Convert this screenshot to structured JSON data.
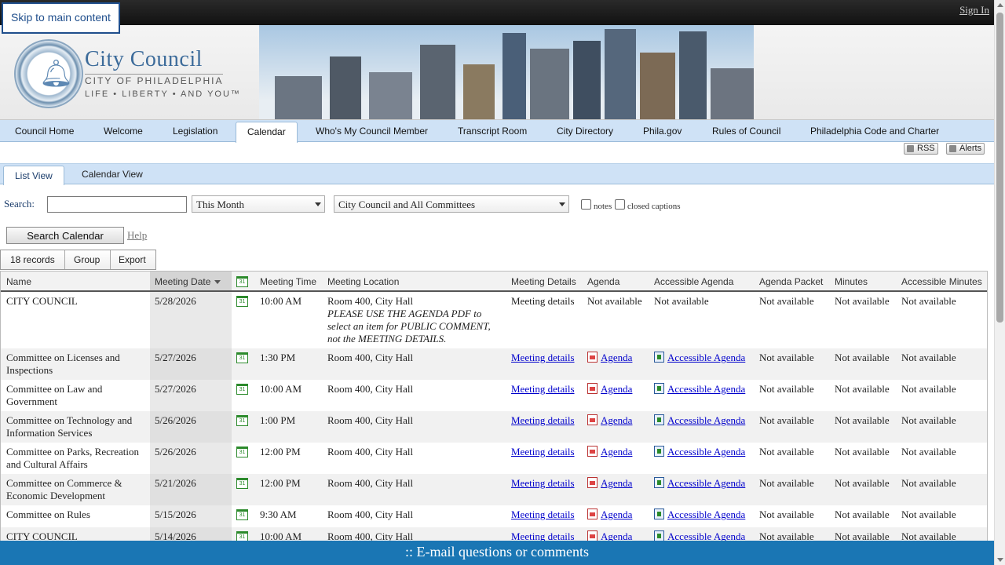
{
  "skip_link": "Skip to main content",
  "signin": "Sign In",
  "logo": {
    "title": "City Council",
    "subtitle": "CITY OF PHILADELPHIA",
    "motto": "LIFE • LIBERTY • AND YOU™"
  },
  "nav": {
    "items": [
      "Council Home",
      "Welcome",
      "Legislation",
      "Calendar",
      "Who's My Council Member",
      "Transcript Room",
      "City Directory",
      "Phila.gov",
      "Rules of Council",
      "Philadelphia Code and Charter"
    ],
    "active": "Calendar"
  },
  "feeds": {
    "rss": "RSS",
    "alerts": "Alerts"
  },
  "view_tabs": {
    "list": "List View",
    "calendar": "Calendar View"
  },
  "search": {
    "label": "Search:",
    "value": "",
    "period": "This Month",
    "body": "City Council and All Committees",
    "notes_label": "notes",
    "captions_label": "closed captions",
    "button": "Search Calendar",
    "help": "Help"
  },
  "toolbar": {
    "records": "18 records",
    "group": "Group",
    "export": "Export"
  },
  "table": {
    "headers": {
      "name": "Name",
      "date": "Meeting Date",
      "time": "Meeting Time",
      "location": "Meeting Location",
      "details": "Meeting Details",
      "agenda": "Agenda",
      "accessible_agenda": "Accessible Agenda",
      "packet": "Agenda Packet",
      "minutes": "Minutes",
      "accessible_minutes": "Accessible Minutes"
    },
    "cal_icon_text": "31",
    "not_available": "Not available",
    "rows": [
      {
        "name": "CITY COUNCIL",
        "date": "5/28/2026",
        "time": "10:00 AM",
        "location": "Room 400, City Hall",
        "note": "PLEASE USE THE AGENDA PDF to select an item for PUBLIC COMMENT, not the MEETING DETAILS.",
        "details": "Meeting details",
        "agenda": "Not available",
        "accessible_agenda": "Not available"
      },
      {
        "name": "Committee on Licenses and Inspections",
        "date": "5/27/2026",
        "time": "1:30 PM",
        "location": "Room 400, City Hall",
        "details": "Meeting details",
        "agenda": "Agenda",
        "accessible_agenda": "Accessible Agenda"
      },
      {
        "name": "Committee on Law and Government",
        "date": "5/27/2026",
        "time": "10:00 AM",
        "location": "Room 400, City Hall",
        "details": "Meeting details",
        "agenda": "Agenda",
        "accessible_agenda": "Accessible Agenda"
      },
      {
        "name": "Committee on Technology and Information Services",
        "date": "5/26/2026",
        "time": "1:00 PM",
        "location": "Room 400, City Hall",
        "details": "Meeting details",
        "agenda": "Agenda",
        "accessible_agenda": "Accessible Agenda"
      },
      {
        "name": "Committee on Parks, Recreation and Cultural Affairs",
        "date": "5/26/2026",
        "time": "12:00 PM",
        "location": "Room 400, City Hall",
        "details": "Meeting details",
        "agenda": "Agenda",
        "accessible_agenda": "Accessible Agenda"
      },
      {
        "name": "Committee on Commerce & Economic Development",
        "date": "5/21/2026",
        "time": "12:00 PM",
        "location": "Room 400, City Hall",
        "details": "Meeting details",
        "agenda": "Agenda",
        "accessible_agenda": "Accessible Agenda"
      },
      {
        "name": "Committee on Rules",
        "date": "5/15/2026",
        "time": "9:30 AM",
        "location": "Room 400, City Hall",
        "details": "Meeting details",
        "agenda": "Agenda",
        "accessible_agenda": "Accessible Agenda"
      },
      {
        "name": "CITY COUNCIL",
        "date": "5/14/2026",
        "time": "10:00 AM",
        "location": "Room 400, City Hall",
        "details": "Meeting details",
        "agenda": "Agenda",
        "accessible_agenda": "Accessible Agenda"
      }
    ]
  },
  "footer": ":: E-mail questions or comments"
}
